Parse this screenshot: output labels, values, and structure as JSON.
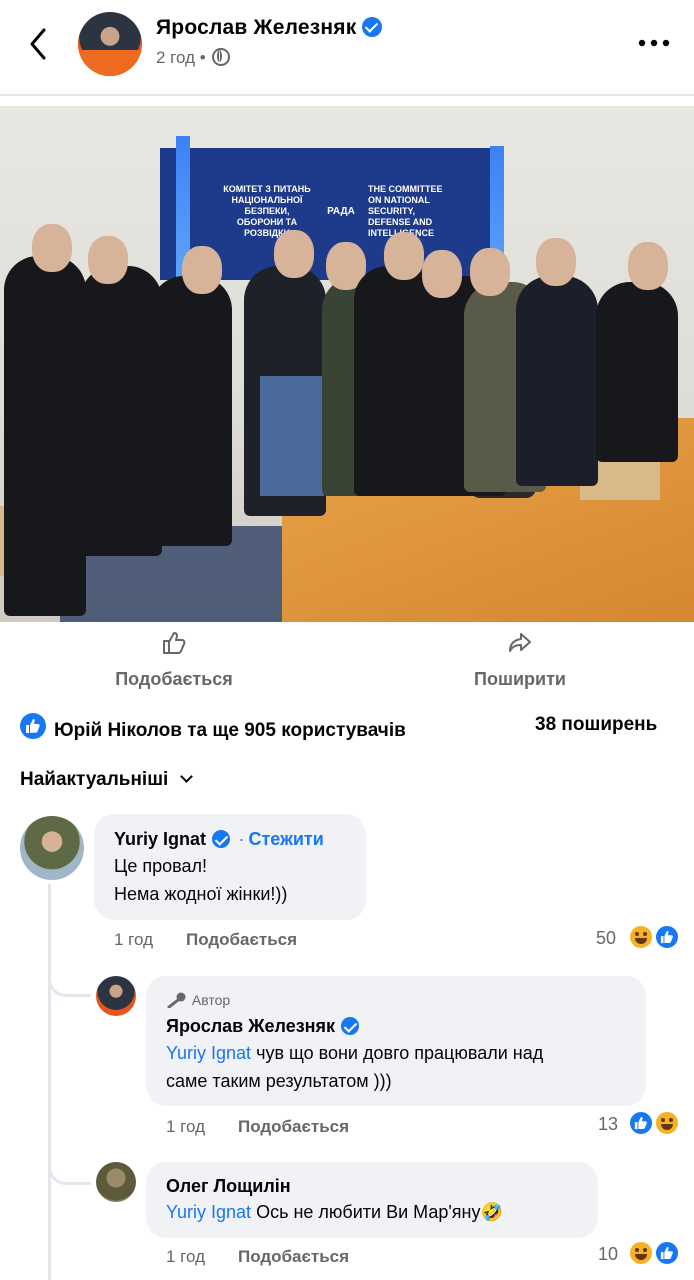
{
  "header": {
    "author": "Ярослав Железняк",
    "time": "2 год",
    "separator": "•"
  },
  "post_actions": {
    "like_label": "Подобається",
    "share_label": "Поширити"
  },
  "photo": {
    "banner_left": "КОМІТЕТ З ПИТАНЬ НАЦІОНАЛЬНОЇ БЕЗПЕКИ, ОБОРОНИ ТА РОЗВІДКИ",
    "banner_right": "THE COMMITTEE ON NATIONAL SECURITY, DEFENSE AND INTELLIGENCE",
    "banner_center": "РАДА"
  },
  "reactions_summary": {
    "text": "Юрій Ніколов та ще 905 користувачів",
    "shares": "38 поширень"
  },
  "sort": {
    "label": "Найактуальніші"
  },
  "comments": [
    {
      "name": "Yuriy Ignat",
      "follow": "Стежити",
      "dot": "·",
      "lines": [
        "Це провал!",
        "Нема жодної жінки!))"
      ],
      "time": "1 год",
      "like": "Подобається",
      "count": "50"
    },
    {
      "tag": "Автор",
      "name": "Ярослав Железняк",
      "mention": "Yuriy Ignat",
      "text1": " чув що вони довго працювали над",
      "text2": "саме таким результатом )))",
      "time": "1 год",
      "like": "Подобається",
      "count": "13"
    },
    {
      "name": "Олег Лощилін",
      "mention": "Yuriy Ignat",
      "text": " Ось не любити Ви Мар'яну🤣",
      "time": "1 год",
      "like": "Подобається",
      "count": "10"
    }
  ]
}
